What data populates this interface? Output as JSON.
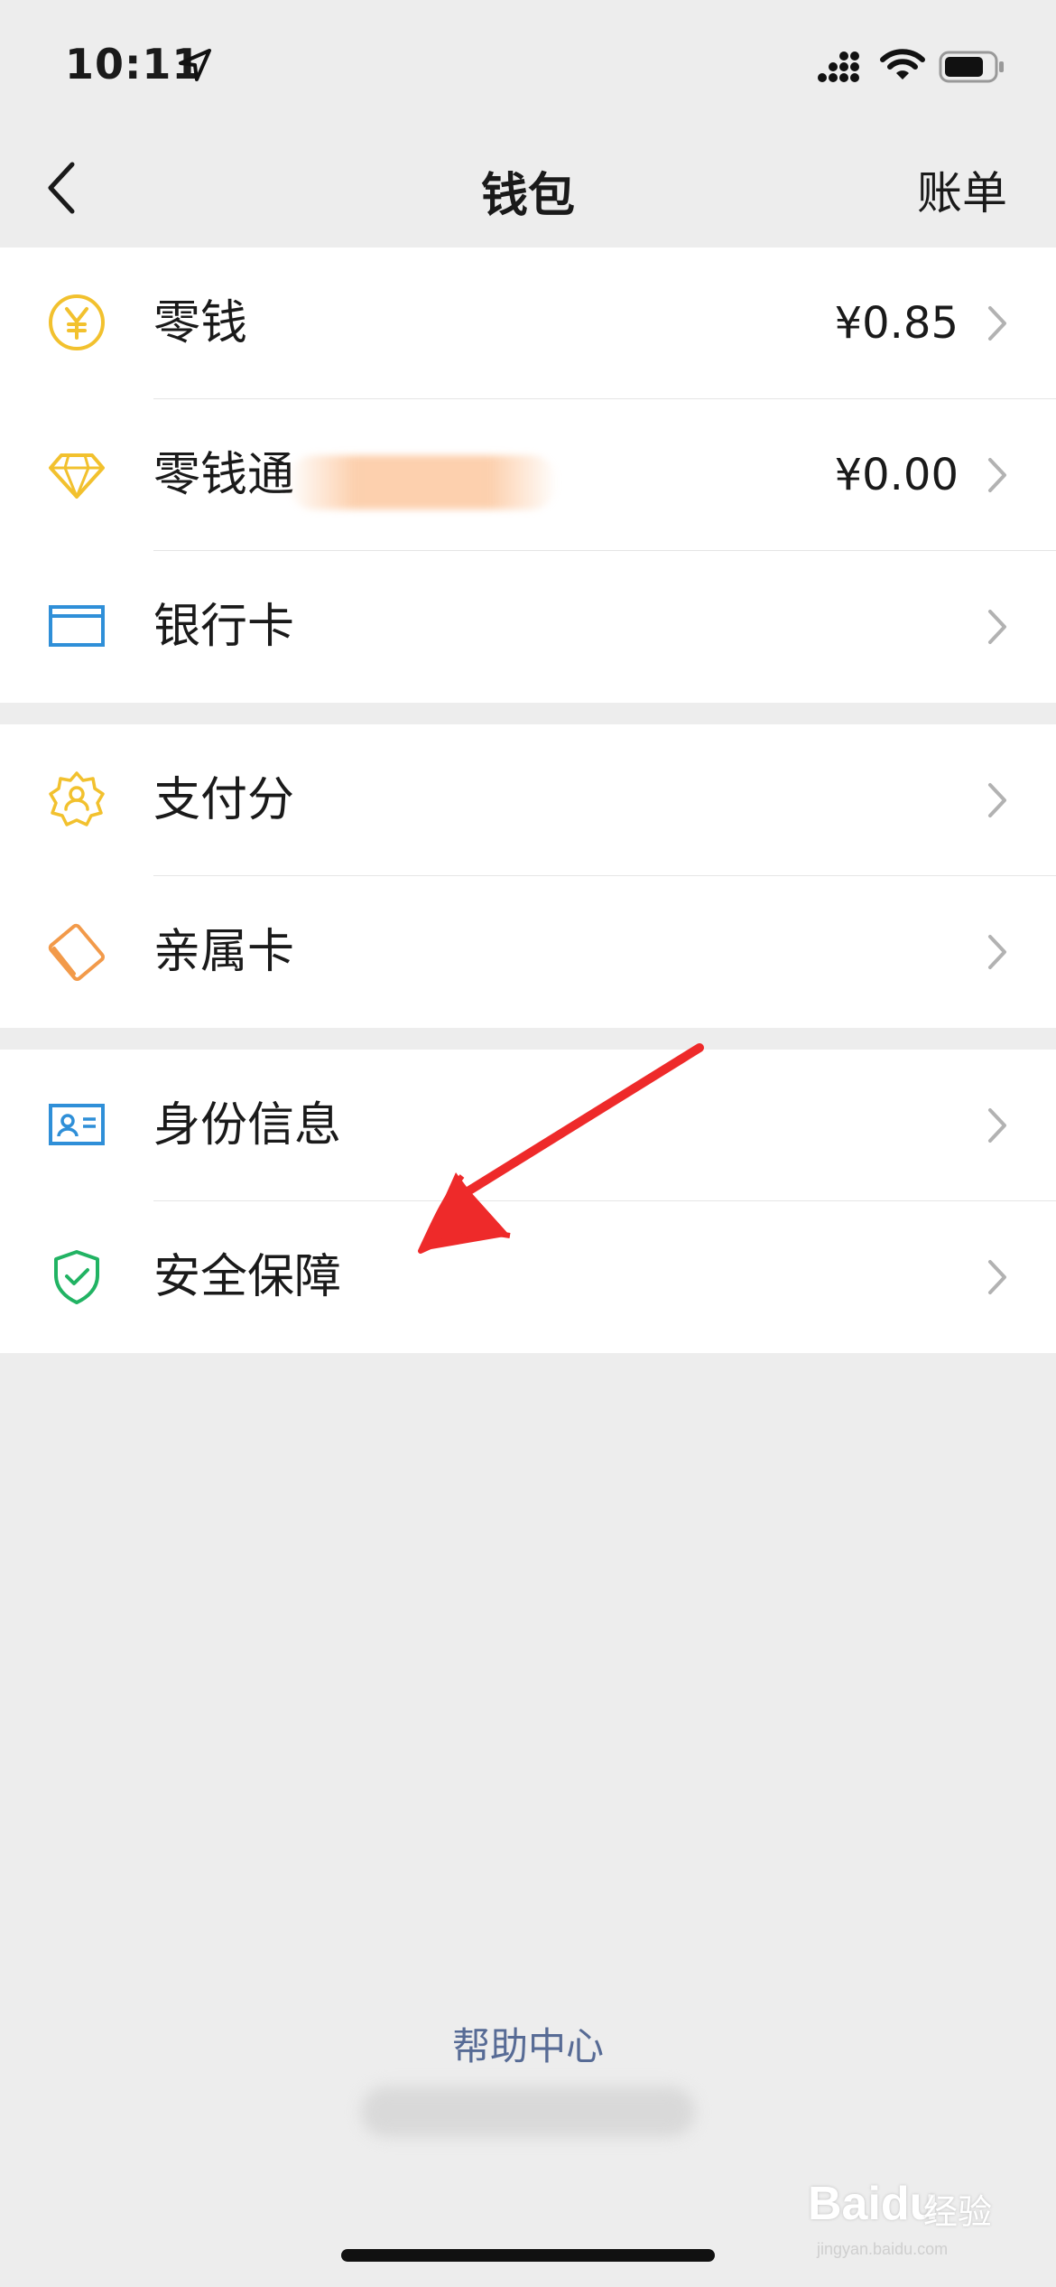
{
  "status_bar": {
    "time": "10:11"
  },
  "nav": {
    "title": "钱包",
    "right_action": "账单"
  },
  "groups": [
    {
      "items": [
        {
          "label": "零钱",
          "value": "¥0.85",
          "icon": "yuan-coin-icon",
          "icon_color": "#f2c12e"
        },
        {
          "label": "零钱通",
          "value": "¥0.00",
          "icon": "diamond-icon",
          "icon_color": "#f2c12e"
        },
        {
          "label": "银行卡",
          "value": "",
          "icon": "bank-card-icon",
          "icon_color": "#2f8fd8"
        }
      ]
    },
    {
      "items": [
        {
          "label": "支付分",
          "value": "",
          "icon": "badge-icon",
          "icon_color": "#f2c12e"
        },
        {
          "label": "亲属卡",
          "value": "",
          "icon": "family-card-icon",
          "icon_color": "#f29a4a"
        }
      ]
    },
    {
      "items": [
        {
          "label": "身份信息",
          "value": "",
          "icon": "id-card-icon",
          "icon_color": "#2f8fd8"
        },
        {
          "label": "安全保障",
          "value": "",
          "icon": "shield-check-icon",
          "icon_color": "#21b363"
        }
      ]
    }
  ],
  "footer": {
    "help_center": "帮助中心"
  },
  "watermark": {
    "logo": "Baidu",
    "cn": "经验",
    "url": "jingyan.baidu.com"
  },
  "colors": {
    "page_bg": "#ededed",
    "link": "#576b95",
    "annotation_arrow": "#ee2a2a"
  }
}
